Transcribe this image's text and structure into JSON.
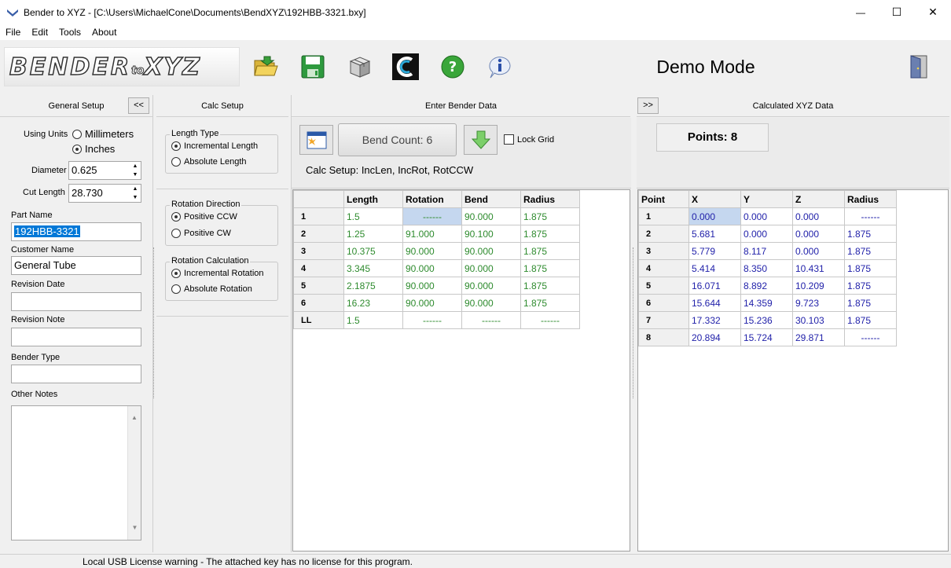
{
  "window": {
    "title": "Bender to XYZ - [C:\\Users\\MichaelCone\\Documents\\BendXYZ\\192HBB-3321.bxy]",
    "minimize": "—",
    "maximize": "☐",
    "close": "✕"
  },
  "menu": [
    "File",
    "Edit",
    "Tools",
    "About"
  ],
  "toolbar": {
    "logo_main": "BENDER",
    "logo_to": "to",
    "logo_xyz": "XYZ",
    "mode": "Demo Mode",
    "icons": [
      "open-folder-icon",
      "save-disk-icon",
      "box-icon",
      "c-logo-icon",
      "help-icon",
      "info-icon",
      "exit-door-icon"
    ]
  },
  "general_setup": {
    "header": "General Setup",
    "collapse": "<<",
    "units_label": "Using Units",
    "unit_mm": "Millimeters",
    "unit_in": "Inches",
    "diameter_label": "Diameter",
    "diameter": "0.625",
    "cut_length_label": "Cut Length",
    "cut_length": "28.730",
    "part_name_label": "Part Name",
    "part_name": "192HBB-3321",
    "customer_label": "Customer Name",
    "customer": "General Tube",
    "revision_date_label": "Revision Date",
    "revision_date": "",
    "revision_note_label": "Revision Note",
    "revision_note": "",
    "bender_type_label": "Bender Type",
    "bender_type": "",
    "other_notes_label": "Other Notes",
    "other_notes": ""
  },
  "calc_setup": {
    "header": "Calc Setup",
    "length_type": "Length Type",
    "incremental_length": "Incremental Length",
    "absolute_length": "Absolute Length",
    "rotation_direction": "Rotation Direction",
    "positive_ccw": "Positive CCW",
    "positive_cw": "Positive CW",
    "rotation_calc": "Rotation Calculation",
    "incremental_rotation": "Incremental Rotation",
    "absolute_rotation": "Absolute Rotation"
  },
  "bender_data": {
    "header": "Enter Bender Data",
    "bend_count": "Bend Count: 6",
    "lock_grid": "Lock Grid",
    "calc_setup_summary": "Calc Setup: IncLen, IncRot, RotCCW",
    "columns": [
      "Length",
      "Rotation",
      "Bend",
      "Radius"
    ],
    "rows": [
      {
        "id": "1",
        "length": "1.5",
        "rotation": "------",
        "bend": "90.000",
        "radius": "1.875"
      },
      {
        "id": "2",
        "length": "1.25",
        "rotation": "91.000",
        "bend": "90.100",
        "radius": "1.875"
      },
      {
        "id": "3",
        "length": "10.375",
        "rotation": "90.000",
        "bend": "90.000",
        "radius": "1.875"
      },
      {
        "id": "4",
        "length": "3.345",
        "rotation": "90.000",
        "bend": "90.000",
        "radius": "1.875"
      },
      {
        "id": "5",
        "length": "2.1875",
        "rotation": "90.000",
        "bend": "90.000",
        "radius": "1.875"
      },
      {
        "id": "6",
        "length": "16.23",
        "rotation": "90.000",
        "bend": "90.000",
        "radius": "1.875"
      },
      {
        "id": "LL",
        "length": "1.5",
        "rotation": "------",
        "bend": "------",
        "radius": "------"
      }
    ]
  },
  "xyz_data": {
    "header": "Calculated XYZ Data",
    "expand": ">>",
    "points": "Points: 8",
    "columns": [
      "Point",
      "X",
      "Y",
      "Z",
      "Radius"
    ],
    "rows": [
      {
        "id": "1",
        "x": "0.000",
        "y": "0.000",
        "z": "0.000",
        "radius": "------"
      },
      {
        "id": "2",
        "x": "5.681",
        "y": "0.000",
        "z": "0.000",
        "radius": "1.875"
      },
      {
        "id": "3",
        "x": "5.779",
        "y": "8.117",
        "z": "0.000",
        "radius": "1.875"
      },
      {
        "id": "4",
        "x": "5.414",
        "y": "8.350",
        "z": "10.431",
        "radius": "1.875"
      },
      {
        "id": "5",
        "x": "16.071",
        "y": "8.892",
        "z": "10.209",
        "radius": "1.875"
      },
      {
        "id": "6",
        "x": "15.644",
        "y": "14.359",
        "z": "9.723",
        "radius": "1.875"
      },
      {
        "id": "7",
        "x": "17.332",
        "y": "15.236",
        "z": "30.103",
        "radius": "1.875"
      },
      {
        "id": "8",
        "x": "20.894",
        "y": "15.724",
        "z": "29.871",
        "radius": "------"
      }
    ]
  },
  "status": "Local USB License warning - The attached key has no license for this program.",
  "colors": {
    "length_green": "#2e8b2e",
    "xyz_blue": "#2222aa",
    "selection": "#c5d7ef"
  }
}
